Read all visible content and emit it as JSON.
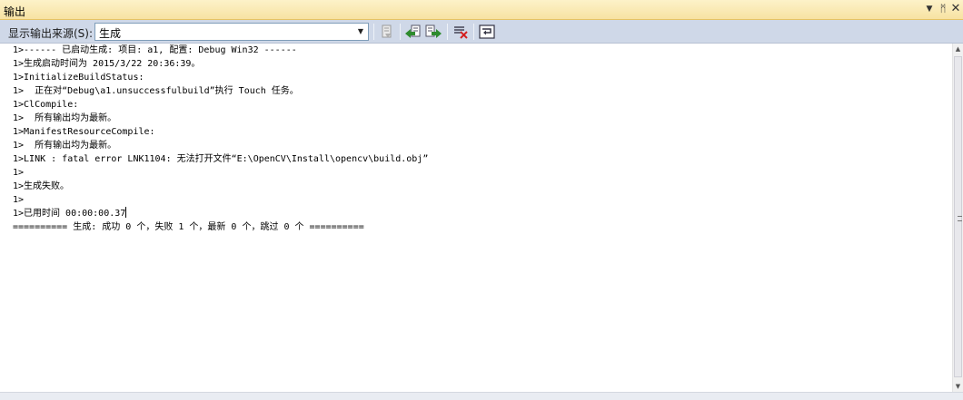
{
  "window": {
    "title": "输出"
  },
  "title_controls": {
    "dropdown": "▼",
    "pin": "ᛗ",
    "close": "✕"
  },
  "toolbar": {
    "source_label": "显示输出来源(S):",
    "source_value": "生成",
    "buttons": [
      {
        "name": "goto-error-button",
        "icon": "goto-line-icon"
      },
      {
        "name": "prev-message-button",
        "icon": "previous-message-icon"
      },
      {
        "name": "next-message-button",
        "icon": "next-message-icon"
      },
      {
        "name": "clear-all-button",
        "icon": "clear-all-icon"
      },
      {
        "name": "word-wrap-button",
        "icon": "word-wrap-icon"
      }
    ]
  },
  "output": {
    "lines": [
      "1>------ 已启动生成: 项目: a1, 配置: Debug Win32 ------",
      "1>生成启动时间为 2015/3/22 20:36:39。",
      "1>InitializeBuildStatus:",
      "1>  正在对“Debug\\a1.unsuccessfulbuild”执行 Touch 任务。",
      "1>ClCompile:",
      "1>  所有输出均为最新。",
      "1>ManifestResourceCompile:",
      "1>  所有输出均为最新。",
      "1>LINK : fatal error LNK1104: 无法打开文件“E:\\OpenCV\\Install\\opencv\\build.obj”",
      "1>",
      "1>生成失败。",
      "1>",
      "1>已用时间 00:00:00.37",
      "========== 生成: 成功 0 个，失败 1 个，最新 0 个，跳过 0 个 =========="
    ]
  },
  "colors": {
    "title_bg": "#f7e2a2",
    "toolbar_bg": "#cfd8e8"
  }
}
